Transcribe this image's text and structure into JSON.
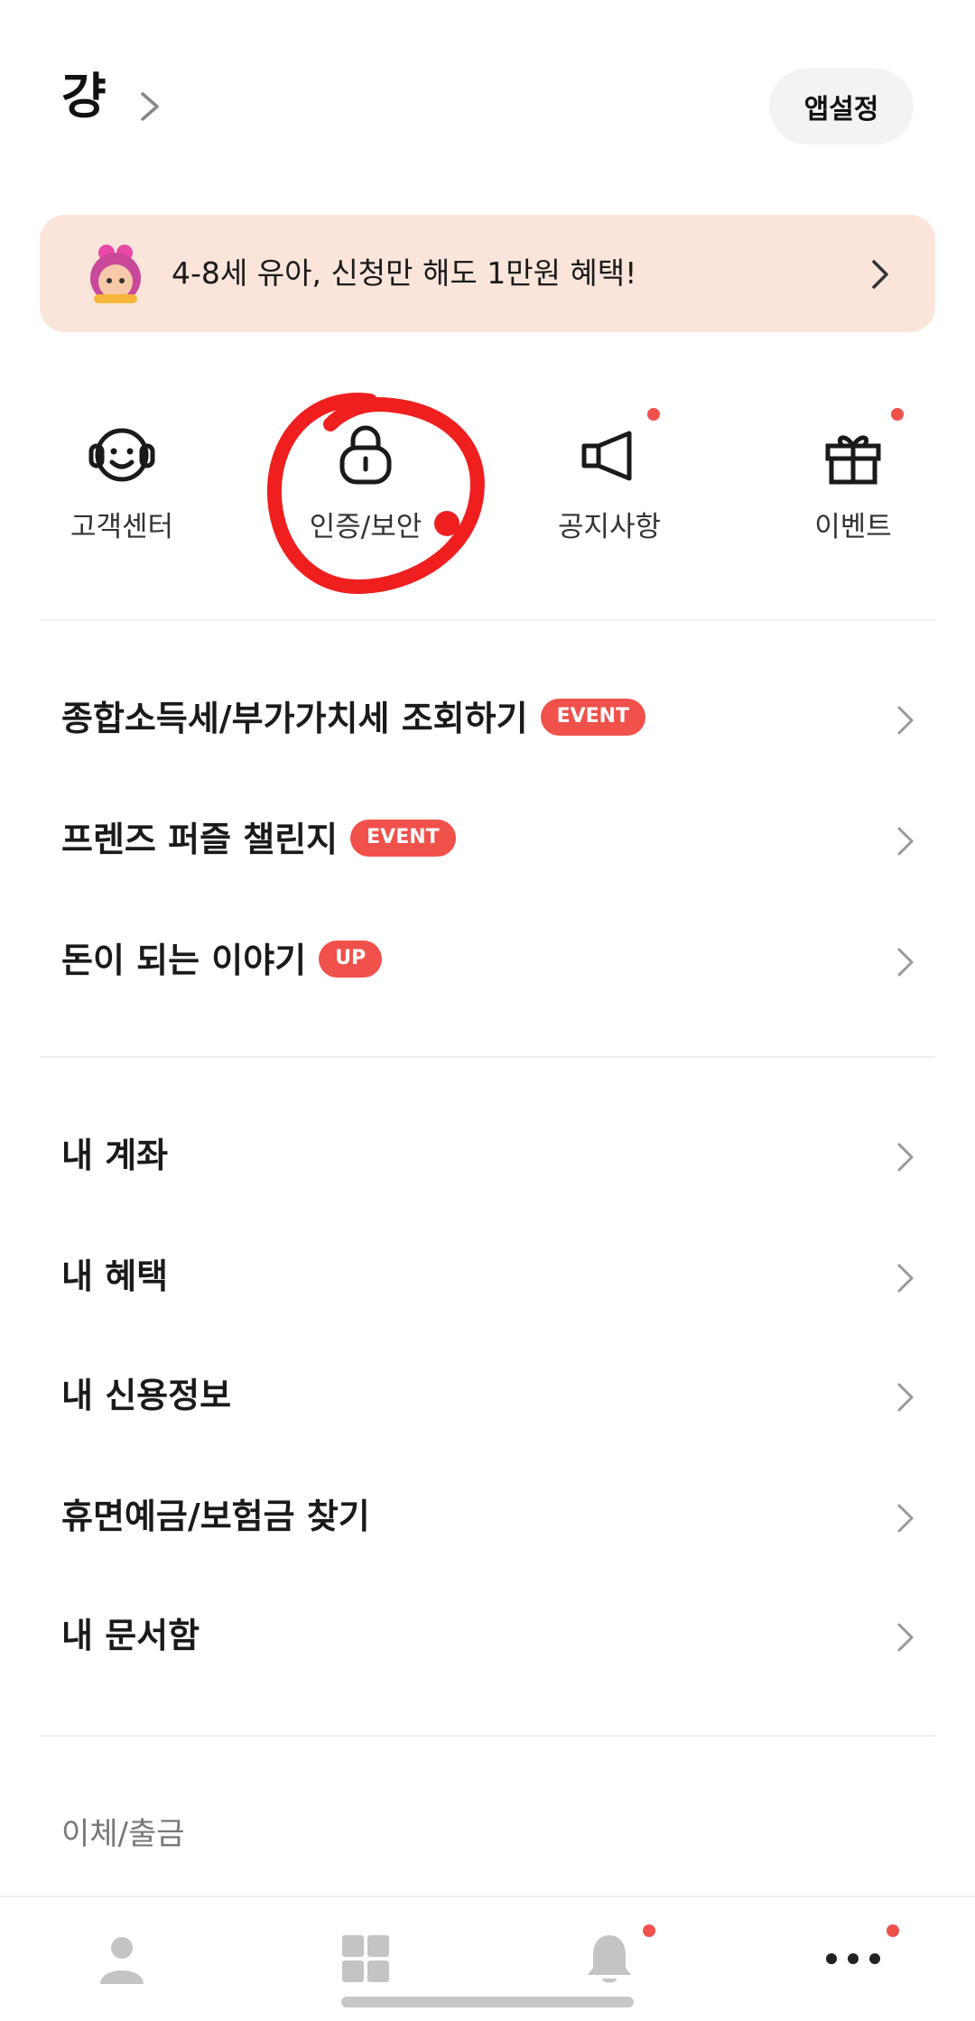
{
  "header": {
    "user_name": "걍",
    "settings_label": "앱설정"
  },
  "banner": {
    "text": "4-8세 유아, 신청만 해도 1만원 혜택!"
  },
  "quick_menu": [
    {
      "label": "고객센터",
      "icon": "headset-icon",
      "has_dot": false
    },
    {
      "label": "인증/보안",
      "icon": "lock-icon",
      "has_dot": false
    },
    {
      "label": "공지사항",
      "icon": "megaphone-icon",
      "has_dot": true
    },
    {
      "label": "이벤트",
      "icon": "gift-icon",
      "has_dot": true
    }
  ],
  "featured_menu": [
    {
      "label": "종합소득세/부가가치세 조회하기",
      "badge": "EVENT"
    },
    {
      "label": "프렌즈 퍼즐 챌린지",
      "badge": "EVENT"
    },
    {
      "label": "돈이 되는 이야기",
      "badge": "UP"
    }
  ],
  "account_menu": [
    {
      "label": "내 계좌"
    },
    {
      "label": "내 혜택"
    },
    {
      "label": "내 신용정보"
    },
    {
      "label": "휴면예금/보험금 찾기"
    },
    {
      "label": "내 문서함"
    }
  ],
  "section": {
    "transfer_label": "이체/출금"
  },
  "tabbar": [
    {
      "icon": "person-icon",
      "has_dot": false
    },
    {
      "icon": "grid-icon",
      "has_dot": false
    },
    {
      "icon": "bell-icon",
      "has_dot": true
    },
    {
      "icon": "more-icon",
      "has_dot": true
    }
  ],
  "colors": {
    "accent": "#f0514a",
    "banner_bg": "#fbe5da",
    "annotation": "#f01f1f"
  }
}
